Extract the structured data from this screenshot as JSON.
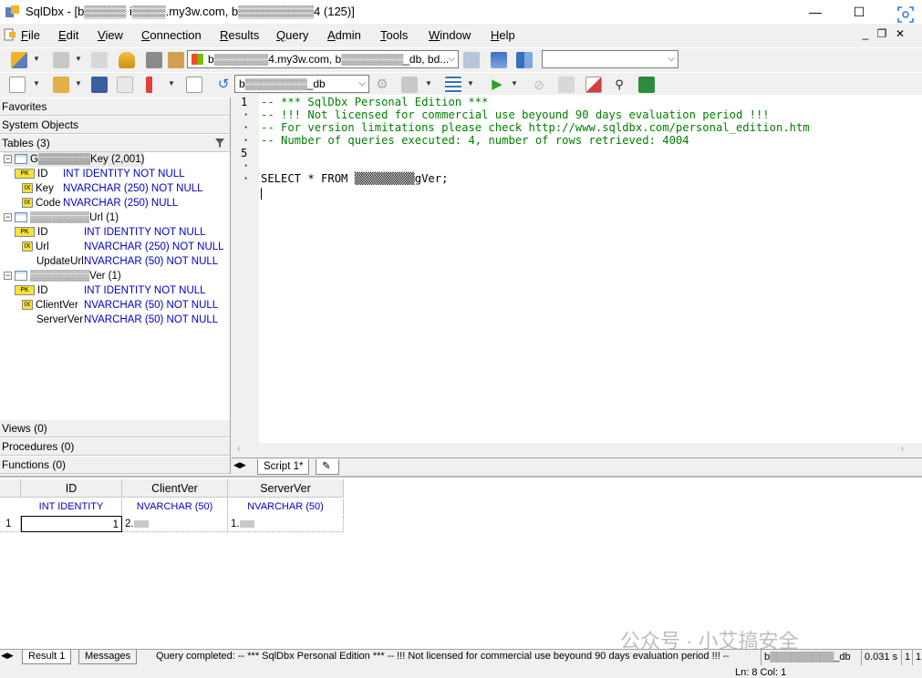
{
  "window": {
    "title": "SqlDbx - [b▒▒▒▒▒ i▒▒▒▒.my3w.com, b▒▒▒▒▒▒▒▒▒4 (125)]",
    "minimize": "—",
    "maximize": "☐",
    "close": "✕"
  },
  "menu": {
    "items": [
      "File",
      "Edit",
      "View",
      "Connection",
      "Results",
      "Query",
      "Admin",
      "Tools",
      "Window",
      "Help"
    ],
    "mdi_min": "_",
    "mdi_restore": "❐",
    "mdi_close": "✕"
  },
  "toolbar": {
    "connection_value": "b▒▒▒▒▒▒▒4.my3w.com, b▒▒▒▒▒▒▒▒_db, bd...",
    "database_value": "b▒▒▒▒▒▒▒▒_db",
    "search_value": ""
  },
  "left_panel": {
    "favorites": "Favorites",
    "system_objects": "System Objects",
    "tables_label": "Tables  (3)",
    "views_label": "Views  (0)",
    "procedures_label": "Procedures  (0)",
    "functions_label": "Functions  (0)",
    "tables": [
      {
        "name": "G▒▒▒▒▒▒▒Key  (2,001)",
        "columns": [
          {
            "name": "ID",
            "type": "INT IDENTITY NOT NULL",
            "badge": "PK"
          },
          {
            "name": "Key",
            "type": "NVARCHAR (250) NOT NULL",
            "badge": "IX"
          },
          {
            "name": "Code",
            "type": "NVARCHAR (250) NULL",
            "badge": "IX"
          }
        ]
      },
      {
        "name": "▒▒▒▒▒▒▒▒Url  (1)",
        "columns": [
          {
            "name": "ID",
            "type": "INT IDENTITY NOT NULL",
            "badge": "PK"
          },
          {
            "name": "Url",
            "type": "NVARCHAR (250) NOT NULL",
            "badge": "IX"
          },
          {
            "name": "UpdateUrl",
            "type": "NVARCHAR (50) NOT NULL",
            "badge": ""
          }
        ]
      },
      {
        "name": "▒▒▒▒▒▒▒▒Ver  (1)",
        "columns": [
          {
            "name": "ID",
            "type": "INT IDENTITY NOT NULL",
            "badge": "PK"
          },
          {
            "name": "ClientVer",
            "type": "NVARCHAR (50) NOT NULL",
            "badge": "IX"
          },
          {
            "name": "ServerVer",
            "type": "NVARCHAR (50) NOT NULL",
            "badge": ""
          }
        ]
      }
    ]
  },
  "editor": {
    "line1": "-- *** SqlDbx Personal Edition ***",
    "line2": "-- !!! Not licensed for commercial use beyound 90 days evaluation period !!!",
    "line3": "-- For version limitations please check http://www.sqldbx.com/personal_edition.htm",
    "line4": "-- Number of queries executed: 4, number of rows retrieved: 4004",
    "line7": "SELECT * FROM ▒▒▒▒▒▒▒▒▒gVer;",
    "gutter_1": "1",
    "gutter_5": "5",
    "tab_label": "Script 1*"
  },
  "results": {
    "columns": [
      {
        "name": "ID",
        "type": "INT IDENTITY"
      },
      {
        "name": "ClientVer",
        "type": "NVARCHAR (50)"
      },
      {
        "name": "ServerVer",
        "type": "NVARCHAR (50)"
      }
    ],
    "row_number": "1",
    "row": [
      "1",
      "2.",
      "1."
    ]
  },
  "bottom": {
    "tab_result": "Result 1",
    "tab_messages": "Messages",
    "status_message": "Query completed: -- *** SqlDbx Personal Edition ***  -- !!! Not licensed for commercial use beyound 90 days evaluation period !!!  -- F...",
    "status_db": "b▒▒▒▒▒▒▒▒▒_db",
    "status_time": "0.031 s",
    "status_rows": "1",
    "status_extra": "1",
    "cursor_pos": "Ln: 8  Col: 1"
  },
  "watermark": "公众号 · 小艾搞安全",
  "colors": {
    "comment": "#008000",
    "type_blue": "#0000c8",
    "badge_yellow": "#f5e23a"
  }
}
